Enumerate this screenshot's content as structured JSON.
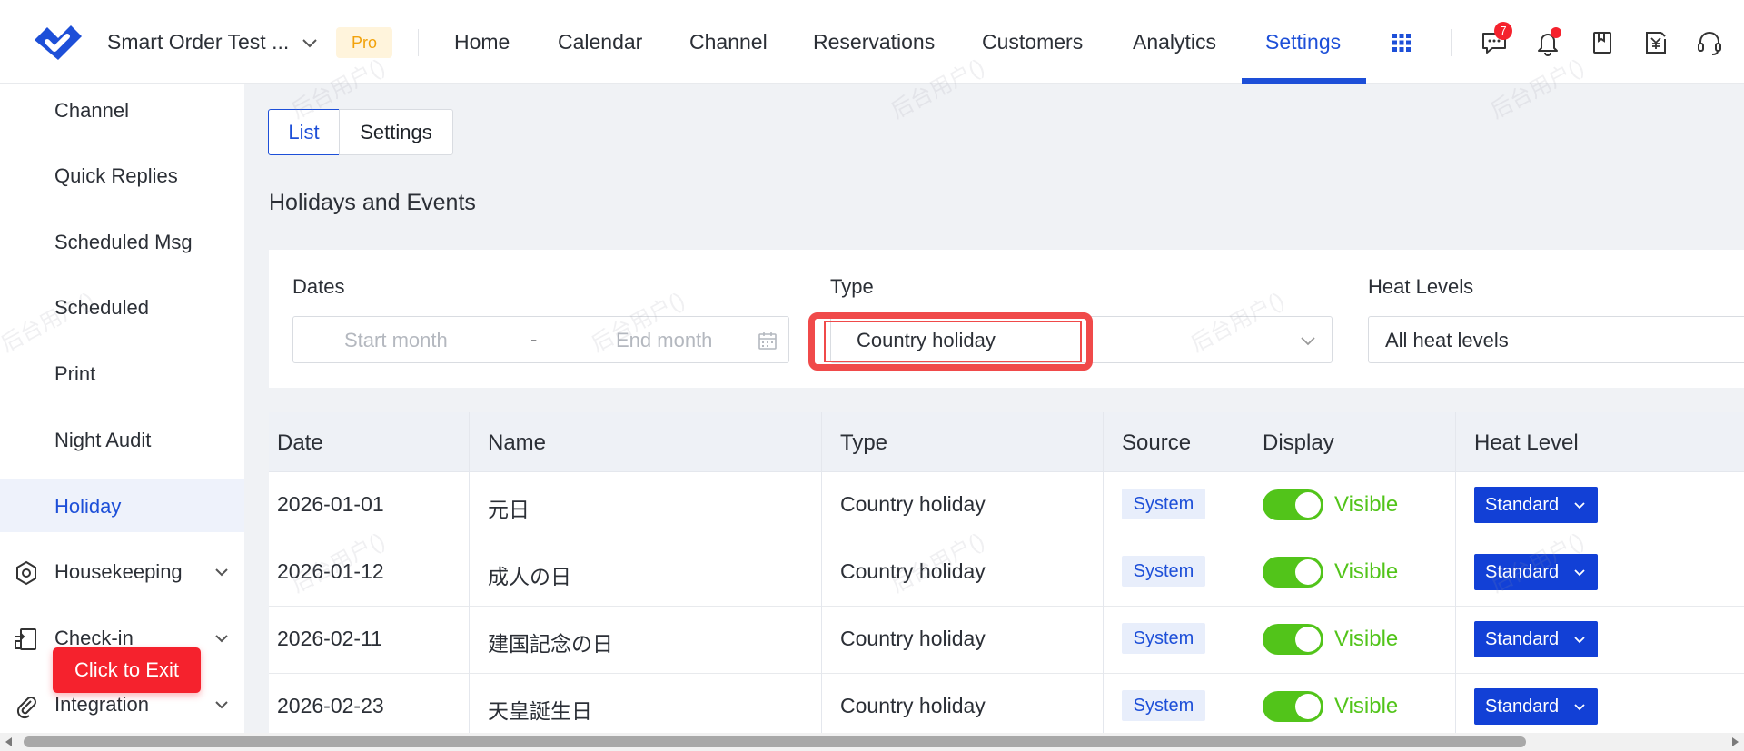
{
  "header": {
    "app_title": "Smart Order Test ...",
    "plan_badge": "Pro",
    "nav": [
      "Home",
      "Calendar",
      "Channel",
      "Reservations",
      "Customers",
      "Analytics",
      "Settings"
    ],
    "active_nav": "Settings",
    "message_count": "7"
  },
  "sidebar": {
    "items": [
      "Channel",
      "Quick Replies",
      "Scheduled Msg",
      "Scheduled",
      "Print",
      "Night Audit",
      "Holiday"
    ],
    "active": "Holiday",
    "groups": [
      "Housekeeping",
      "Check-in",
      "Integration"
    ],
    "exit_button": "Click to Exit"
  },
  "main": {
    "tabs": [
      "List",
      "Settings"
    ],
    "active_tab": "List",
    "section_title": "Holidays and Events",
    "filters": {
      "dates_label": "Dates",
      "start_placeholder": "Start month",
      "range_separator": "-",
      "end_placeholder": "End month",
      "type_label": "Type",
      "type_value": "Country holiday",
      "heat_label": "Heat Levels",
      "heat_value": "All heat levels"
    },
    "table": {
      "columns": [
        "Date",
        "Name",
        "Type",
        "Source",
        "Display",
        "Heat Level"
      ],
      "rows": [
        {
          "date": "2026-01-01",
          "name": "元日",
          "type": "Country holiday",
          "source": "System",
          "display": "Visible",
          "heat": "Standard"
        },
        {
          "date": "2026-01-12",
          "name": "成人の日",
          "type": "Country holiday",
          "source": "System",
          "display": "Visible",
          "heat": "Standard"
        },
        {
          "date": "2026-02-11",
          "name": "建国記念の日",
          "type": "Country holiday",
          "source": "System",
          "display": "Visible",
          "heat": "Standard"
        },
        {
          "date": "2026-02-23",
          "name": "天皇誕生日",
          "type": "Country holiday",
          "source": "System",
          "display": "Visible",
          "heat": "Standard"
        }
      ]
    }
  },
  "watermark_text": "后台用户()",
  "colors": {
    "accent": "#1d4fd8",
    "highlight": "#f04a4a",
    "toggle_on": "#52c41a",
    "pro": "#f2a20b",
    "exit": "#f5222d"
  }
}
